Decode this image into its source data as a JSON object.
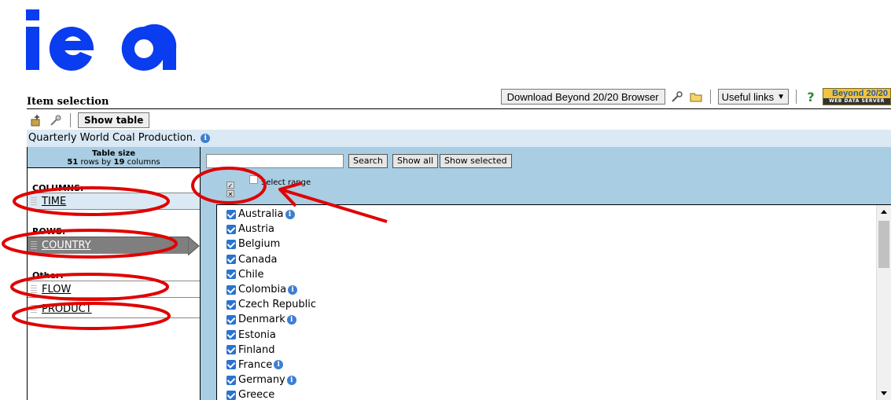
{
  "logo": {
    "text": "iea"
  },
  "header": {
    "item_selection": "Item selection"
  },
  "topbar": {
    "download_label": "Download Beyond 20/20 Browser",
    "useful_links": "Useful links",
    "brand_top": "Beyond 20/20",
    "brand_bottom": "WEB DATA SERVER"
  },
  "toolbar": {
    "show_table": "Show table"
  },
  "dataset_title": "Quarterly World Coal Production.",
  "table_size": {
    "label": "Table size",
    "rows": "51",
    "rows_by": " rows by ",
    "cols": "19",
    "cols_suffix": " columns"
  },
  "dimensions": {
    "columns_label": "COLUMNS:",
    "rows_label": "ROWS:",
    "other_label": "Other:",
    "time": "TIME",
    "country": "COUNTRY",
    "flow": "FLOW",
    "product": "PRODUCT"
  },
  "search": {
    "search_btn": "Search",
    "show_all": "Show all",
    "show_selected": "Show selected",
    "select_range": "Select range"
  },
  "countries": [
    {
      "name": "Australia",
      "info": true
    },
    {
      "name": "Austria",
      "info": false
    },
    {
      "name": "Belgium",
      "info": false
    },
    {
      "name": "Canada",
      "info": false
    },
    {
      "name": "Chile",
      "info": false
    },
    {
      "name": "Colombia",
      "info": true
    },
    {
      "name": "Czech Republic",
      "info": false
    },
    {
      "name": "Denmark",
      "info": true
    },
    {
      "name": "Estonia",
      "info": false
    },
    {
      "name": "Finland",
      "info": false
    },
    {
      "name": "France",
      "info": true
    },
    {
      "name": "Germany",
      "info": true
    },
    {
      "name": "Greece",
      "info": false
    }
  ],
  "colors": {
    "annotation_red": "#e00000",
    "light_blue": "#a9cde3",
    "title_bar": "#dbe9f4",
    "checkbox_blue": "#2a73d0"
  }
}
